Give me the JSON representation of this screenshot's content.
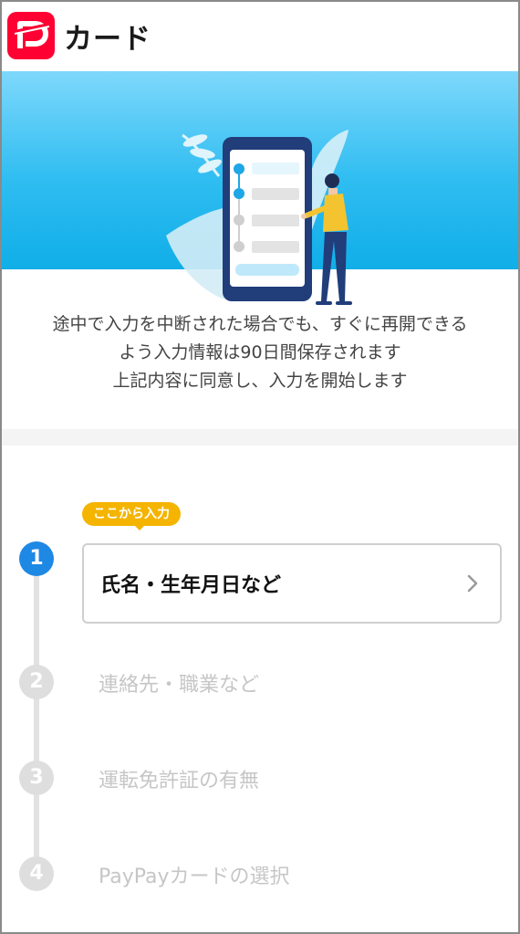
{
  "header": {
    "logo_icon": "paypay-logo-icon",
    "title": "カード",
    "brand_color": "#ff0033"
  },
  "hero": {
    "gradient_top": "#7ed8fb",
    "gradient_bottom": "#10aee8"
  },
  "intro": {
    "lines": [
      "途中で入力を中断された場合でも、すぐに再開できる",
      "よう入力情報は90日間保存されます",
      "上記内容に同意し、入力を開始します"
    ]
  },
  "steps": {
    "badge": "ここから入力",
    "items": [
      {
        "number": "1",
        "label": "氏名・生年月日など",
        "active": true
      },
      {
        "number": "2",
        "label": "連絡先・職業など",
        "active": false
      },
      {
        "number": "3",
        "label": "運転免許証の有無",
        "active": false
      },
      {
        "number": "4",
        "label": "PayPayカードの選択",
        "active": false
      }
    ],
    "active_color": "#1e88e5",
    "badge_color": "#f4b400"
  }
}
